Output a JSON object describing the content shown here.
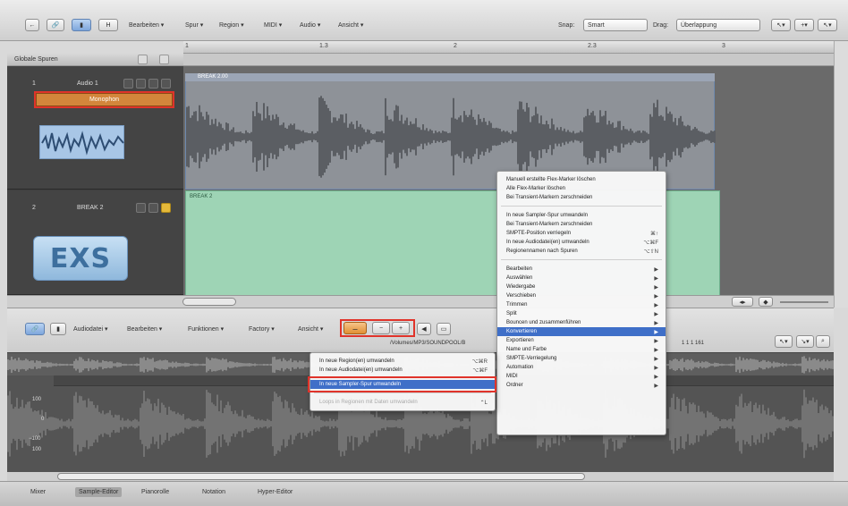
{
  "toolbar": {
    "menus": [
      "Bearbeiten",
      "Spur",
      "Region",
      "MIDI",
      "Audio",
      "Ansicht"
    ],
    "snap_label": "Snap:",
    "snap_value": "Smart",
    "drag_label": "Drag:",
    "drag_value": "Überlappung",
    "h_label": "H"
  },
  "ruler": {
    "ticks": [
      "1",
      "1.3",
      "2",
      "2.3",
      "3"
    ]
  },
  "global_tracks": "Globale Spuren",
  "tracks": [
    {
      "number": "1",
      "name": "Audio 1",
      "flex_label": "Monophon"
    },
    {
      "number": "2",
      "name": "BREAK 2",
      "logo": "EXS"
    }
  ],
  "regions": [
    {
      "name": "BREAK 2.00"
    },
    {
      "name": "BREAK 2"
    }
  ],
  "region_context_menu": {
    "group1": [
      {
        "label": "Manuell erstellte Flex-Marker löschen",
        "shortcut": ""
      },
      {
        "label": "Alle Flex-Marker löschen",
        "shortcut": ""
      },
      {
        "label": "Bei Transient-Markern zerschneiden",
        "shortcut": ""
      }
    ],
    "group2": [
      {
        "label": "In neue Sampler-Spur umwandeln",
        "shortcut": ""
      },
      {
        "label": "Bei Transient-Markern zerschneiden",
        "shortcut": ""
      },
      {
        "label": "SMPTE-Position verriegeln",
        "shortcut": "⌘↑"
      },
      {
        "label": "In neue Audiodatei(en) umwandeln",
        "shortcut": "⌥⌘F"
      },
      {
        "label": "Regionennamen nach Spuren",
        "shortcut": "⌥⇧N"
      }
    ],
    "group3": [
      {
        "label": "Bearbeiten",
        "shortcut": "▶"
      },
      {
        "label": "Auswählen",
        "shortcut": "▶"
      },
      {
        "label": "Wiedergabe",
        "shortcut": "▶"
      },
      {
        "label": "Verschieben",
        "shortcut": "▶"
      },
      {
        "label": "Trimmen",
        "shortcut": "▶"
      },
      {
        "label": "Split",
        "shortcut": "▶"
      },
      {
        "label": "Bouncen und zusammenführen",
        "shortcut": "▶"
      },
      {
        "label": "Konvertieren",
        "shortcut": "▶"
      },
      {
        "label": "Exportieren",
        "shortcut": "▶"
      },
      {
        "label": "Name und Farbe",
        "shortcut": "▶"
      },
      {
        "label": "SMPTE-Verriegelung",
        "shortcut": "▶"
      },
      {
        "label": "Automation",
        "shortcut": "▶"
      },
      {
        "label": "MIDI",
        "shortcut": "▶"
      },
      {
        "label": "Ordner",
        "shortcut": "▶"
      }
    ]
  },
  "convert_submenu": [
    {
      "label": "In neue Region(en) umwandeln",
      "shortcut": "⌥⌘R"
    },
    {
      "label": "In neue Audiodatei(en) umwandeln",
      "shortcut": "⌥⌘F"
    },
    {
      "label": "In neue Sampler-Spur umwandeln",
      "shortcut": ""
    },
    {
      "label": "Loops in Regionen mit Daten umwandeln",
      "shortcut": "⌃L"
    }
  ],
  "editor_toolbar": {
    "menus": [
      "Audiodatei",
      "Bearbeiten",
      "Funktionen",
      "Factory",
      "Ansicht"
    ],
    "path": "/Volumes/MP3/SOUNDPOOL/B",
    "position": "1  1  1  161"
  },
  "sample_scale": [
    "100",
    "0",
    "−100",
    "100"
  ],
  "tabs": [
    "Mixer",
    "Sample-Editor",
    "Pianorolle",
    "Notation",
    "Hyper-Editor"
  ]
}
